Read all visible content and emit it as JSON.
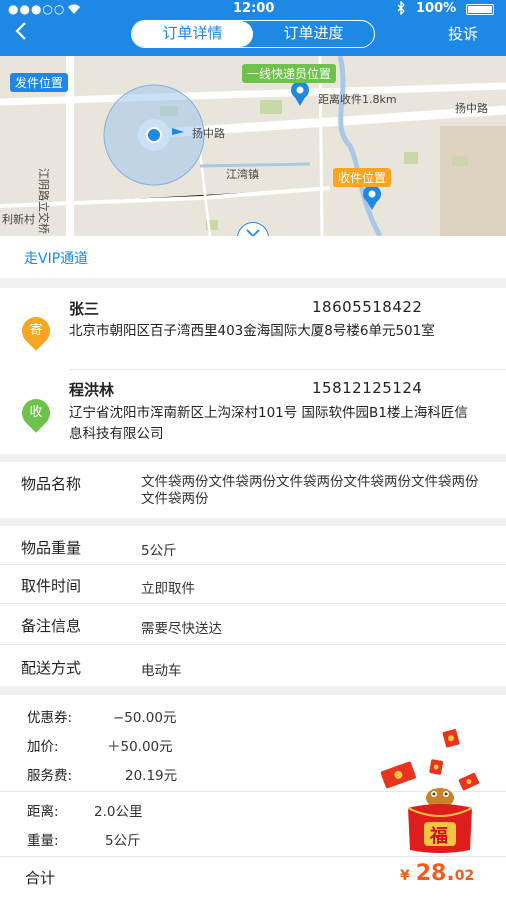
{
  "status": {
    "carrier": "●●●○○",
    "time": "12:00",
    "battery": "100%"
  },
  "header": {
    "tabs": [
      "订单详情",
      "订单进度"
    ],
    "active_tab": 0,
    "complain": "投诉",
    "colors": {
      "primary": "#1e88e5"
    }
  },
  "map": {
    "sender_tag": "发件位置",
    "courier_tag": "一线快递员位置",
    "receiver_tag": "收件位置",
    "distance": "距离收件1.8km",
    "labels": [
      "扬中路",
      "扬中路",
      "江湾镇",
      "江阴路立交桥",
      "利新村"
    ]
  },
  "vip": "走VIP通道",
  "sender": {
    "badge": "寄",
    "name": "张三",
    "phone": "18605518422",
    "address": "北京市朝阳区百子湾西里403金海国际大厦8号楼6单元501室"
  },
  "receiver": {
    "badge": "收",
    "name": "程洪林",
    "phone": "15812125124",
    "address": "辽宁省沈阳市浑南新区上沟深村101号 国际软件园B1楼上海科匠信息科技有限公司"
  },
  "item": {
    "label": "物品名称",
    "value": "文件袋两份文件袋两份文件袋两份文件袋两份文件袋两份文件袋两份"
  },
  "info": [
    {
      "label": "物品重量",
      "value": "5公斤"
    },
    {
      "label": "取件时间",
      "value": "立即取件"
    },
    {
      "label": "备注信息",
      "value": "需要尽快送达"
    },
    {
      "label": "配送方式",
      "value": "电动车"
    }
  ],
  "pricing": [
    {
      "label": "优惠券:",
      "value": "−50.00元"
    },
    {
      "label": "加价:",
      "value": "＋50.00元"
    },
    {
      "label": "服务费:",
      "value": "20.19元"
    }
  ],
  "trip": [
    {
      "label": "距离:",
      "value": "2.0公里"
    },
    {
      "label": "重量:",
      "value": "5公斤"
    }
  ],
  "total": {
    "label": "合计",
    "currency": "¥",
    "integer": "28.",
    "cents": "02"
  },
  "red_packet_char": "福"
}
